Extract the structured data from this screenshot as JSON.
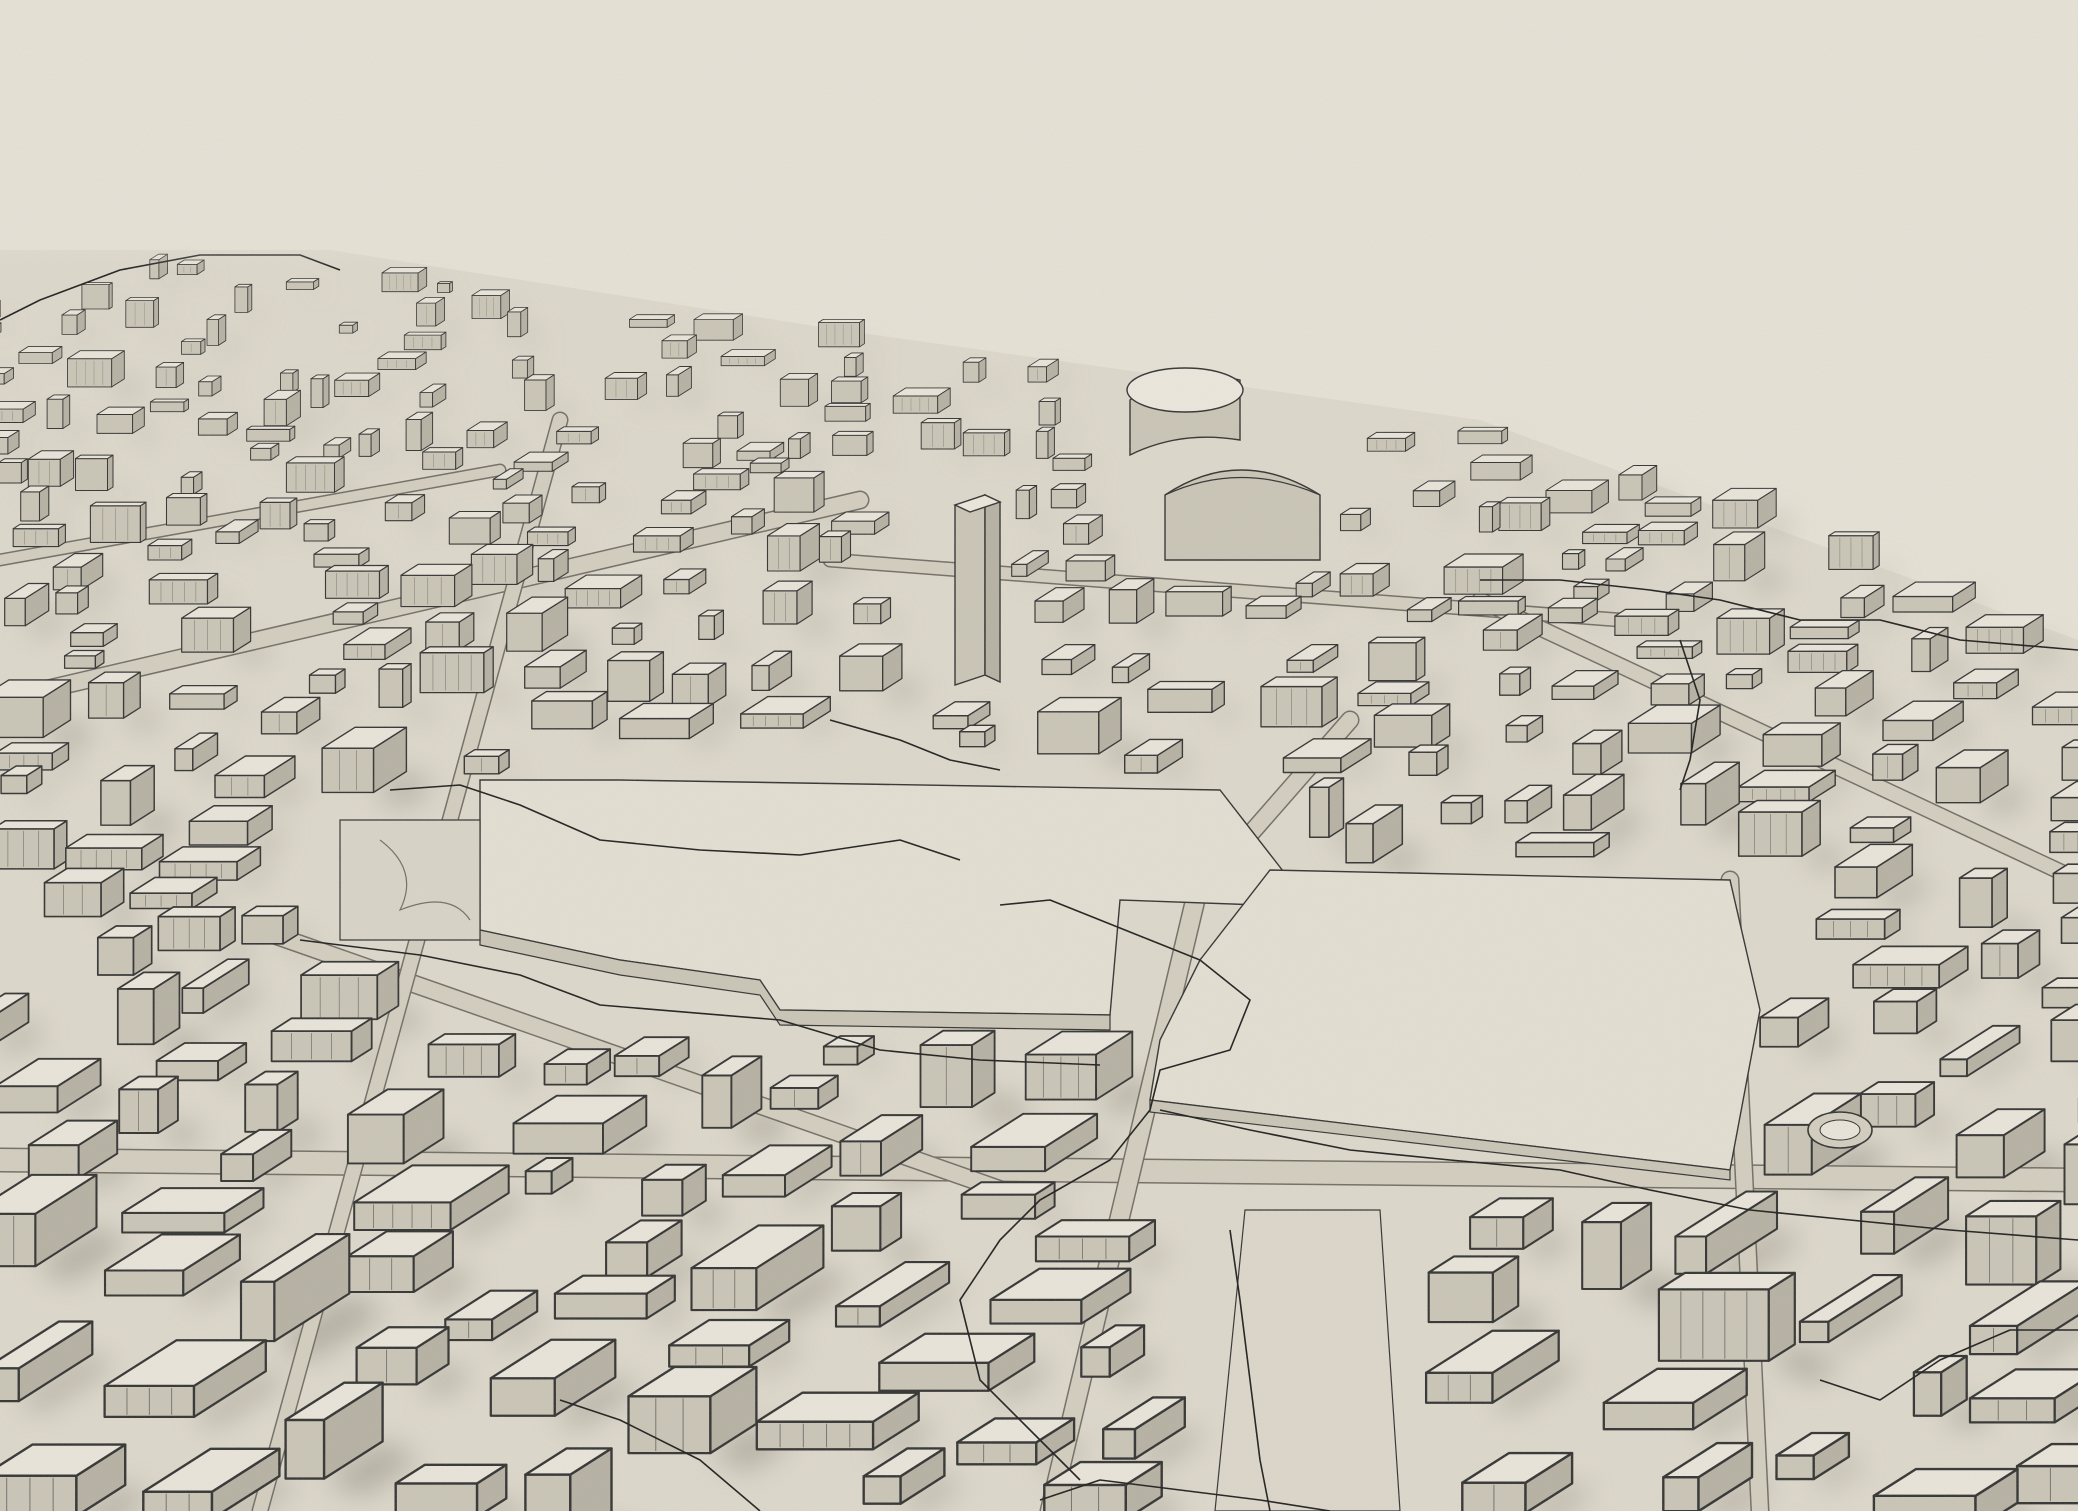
{
  "map": {
    "style": "isometric-sketch-3d-city",
    "colors": {
      "paper": "#e6e2d6",
      "paper_dark": "#d8d3c5",
      "building_top": "#e9e5da",
      "building_side": "#c9c4b6",
      "building_side_dark": "#b5b0a2",
      "outline": "#2e2e2e",
      "shadow": "#8d887c",
      "road": "#d2cdbf",
      "road_edge": "#6f6b62",
      "route_line": "#1a1a1a"
    },
    "labels": []
  }
}
